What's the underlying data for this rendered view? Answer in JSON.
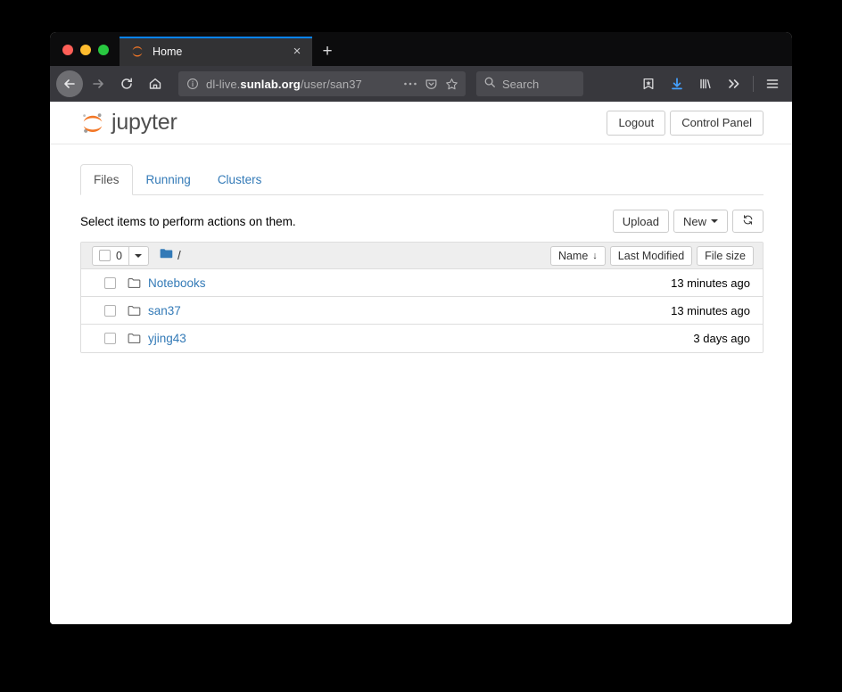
{
  "browser": {
    "tab": {
      "title": "Home",
      "favicon": "jupyter-favicon",
      "close_label": "×"
    },
    "new_tab_label": "+",
    "nav": {
      "back_icon": "arrow-left-icon",
      "forward_icon": "arrow-right-icon",
      "reload_icon": "reload-icon",
      "home_icon": "home-icon"
    },
    "url": {
      "prefix": "dl-live.",
      "domain": "sunlab.org",
      "path": "/user/san37"
    },
    "url_actions": {
      "info_icon": "info-circle-icon",
      "page_actions_icon": "ellipsis-icon",
      "pocket_icon": "pocket-icon",
      "bookmark_icon": "star-icon"
    },
    "search": {
      "placeholder": "Search",
      "icon": "search-icon"
    },
    "toolbar_icons": [
      "save-to-pocket-icon",
      "downloads-icon",
      "library-icon",
      "overflow-icon",
      "menu-icon"
    ]
  },
  "jupyter": {
    "logo_text": "jupyter",
    "header_buttons": [
      {
        "label": "Logout",
        "name": "logout-button"
      },
      {
        "label": "Control Panel",
        "name": "control-panel-button"
      }
    ],
    "tabs": [
      {
        "label": "Files",
        "active": true
      },
      {
        "label": "Running",
        "active": false
      },
      {
        "label": "Clusters",
        "active": false
      }
    ],
    "hint": "Select items to perform actions on them.",
    "actions": {
      "upload_label": "Upload",
      "new_label": "New",
      "refresh_icon": "refresh-icon"
    },
    "list_header": {
      "selected_count": "0",
      "dropdown_icon": "caret-down-icon",
      "breadcrumb_root": "/",
      "folder_icon": "folder-filled-icon",
      "sort_buttons": [
        {
          "label": "Name",
          "arrow": "↓",
          "name": "sort-by-name-button"
        },
        {
          "label": "Last Modified",
          "arrow": "",
          "name": "sort-by-modified-button"
        },
        {
          "label": "File size",
          "arrow": "",
          "name": "sort-by-size-button"
        }
      ]
    },
    "items": [
      {
        "name": "Notebooks",
        "modified": "13 minutes ago",
        "type": "folder"
      },
      {
        "name": "san37",
        "modified": "13 minutes ago",
        "type": "folder"
      },
      {
        "name": "yjing43",
        "modified": "3 days ago",
        "type": "folder"
      }
    ]
  },
  "colors": {
    "link": "#337ab7",
    "jupyter_orange": "#f37726",
    "tab_accent": "#0a84ff",
    "download_blue": "#45a1ff"
  }
}
